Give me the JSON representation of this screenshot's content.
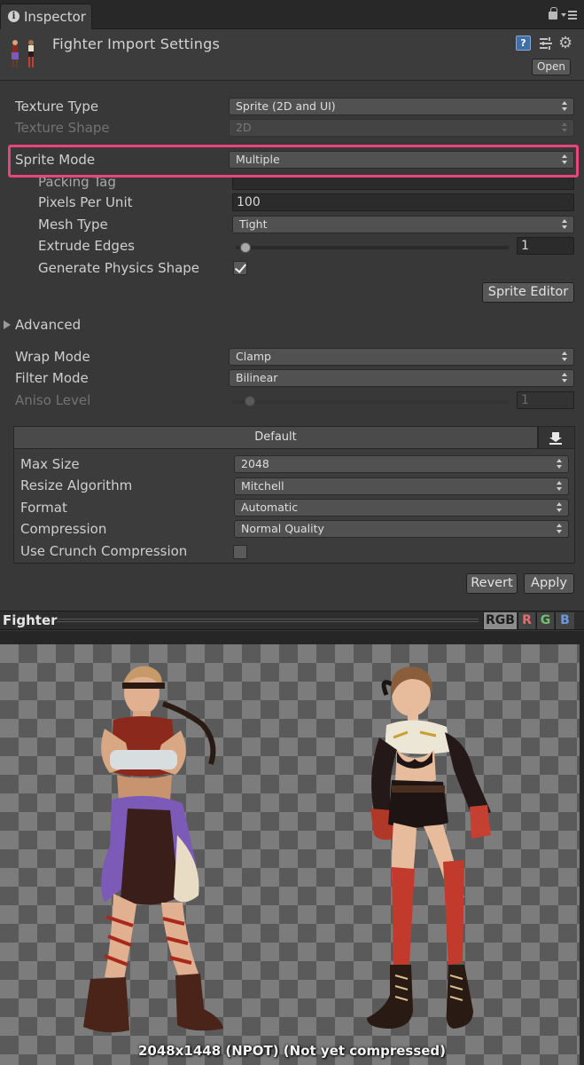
{
  "tab": {
    "title": "Inspector"
  },
  "header": {
    "title": "Fighter Import Settings",
    "open_label": "Open"
  },
  "settings": {
    "texture_type": {
      "label": "Texture Type",
      "value": "Sprite (2D and UI)"
    },
    "texture_shape": {
      "label": "Texture Shape",
      "value": "2D"
    },
    "sprite_mode": {
      "label": "Sprite Mode",
      "value": "Multiple"
    },
    "packing_tag": {
      "label": "Packing Tag",
      "value": ""
    },
    "pixels_per_unit": {
      "label": "Pixels Per Unit",
      "value": "100"
    },
    "mesh_type": {
      "label": "Mesh Type",
      "value": "Tight"
    },
    "extrude_edges": {
      "label": "Extrude Edges",
      "value": "1",
      "slider_fraction": 0.03
    },
    "generate_physics_shape": {
      "label": "Generate Physics Shape",
      "checked": true
    },
    "sprite_editor_label": "Sprite Editor",
    "advanced_label": "Advanced",
    "wrap_mode": {
      "label": "Wrap Mode",
      "value": "Clamp"
    },
    "filter_mode": {
      "label": "Filter Mode",
      "value": "Bilinear"
    },
    "aniso_level": {
      "label": "Aniso Level",
      "value": "1",
      "slider_fraction": 0.06
    }
  },
  "platform": {
    "tab_label": "Default",
    "max_size": {
      "label": "Max Size",
      "value": "2048"
    },
    "resize_algorithm": {
      "label": "Resize Algorithm",
      "value": "Mitchell"
    },
    "format": {
      "label": "Format",
      "value": "Automatic"
    },
    "compression": {
      "label": "Compression",
      "value": "Normal Quality"
    },
    "use_crunch": {
      "label": "Use Crunch Compression",
      "checked": false
    }
  },
  "actions": {
    "revert_label": "Revert",
    "apply_label": "Apply"
  },
  "preview": {
    "title": "Fighter",
    "channels": [
      "RGB",
      "R",
      "G",
      "B"
    ],
    "info": "2048x1448 (NPOT) (Not yet compressed)"
  },
  "colors": {
    "highlight": "#e8457a",
    "panel_bg": "#383838",
    "checker_light": "#7c7c7c",
    "checker_dark": "#5a5a5a"
  }
}
